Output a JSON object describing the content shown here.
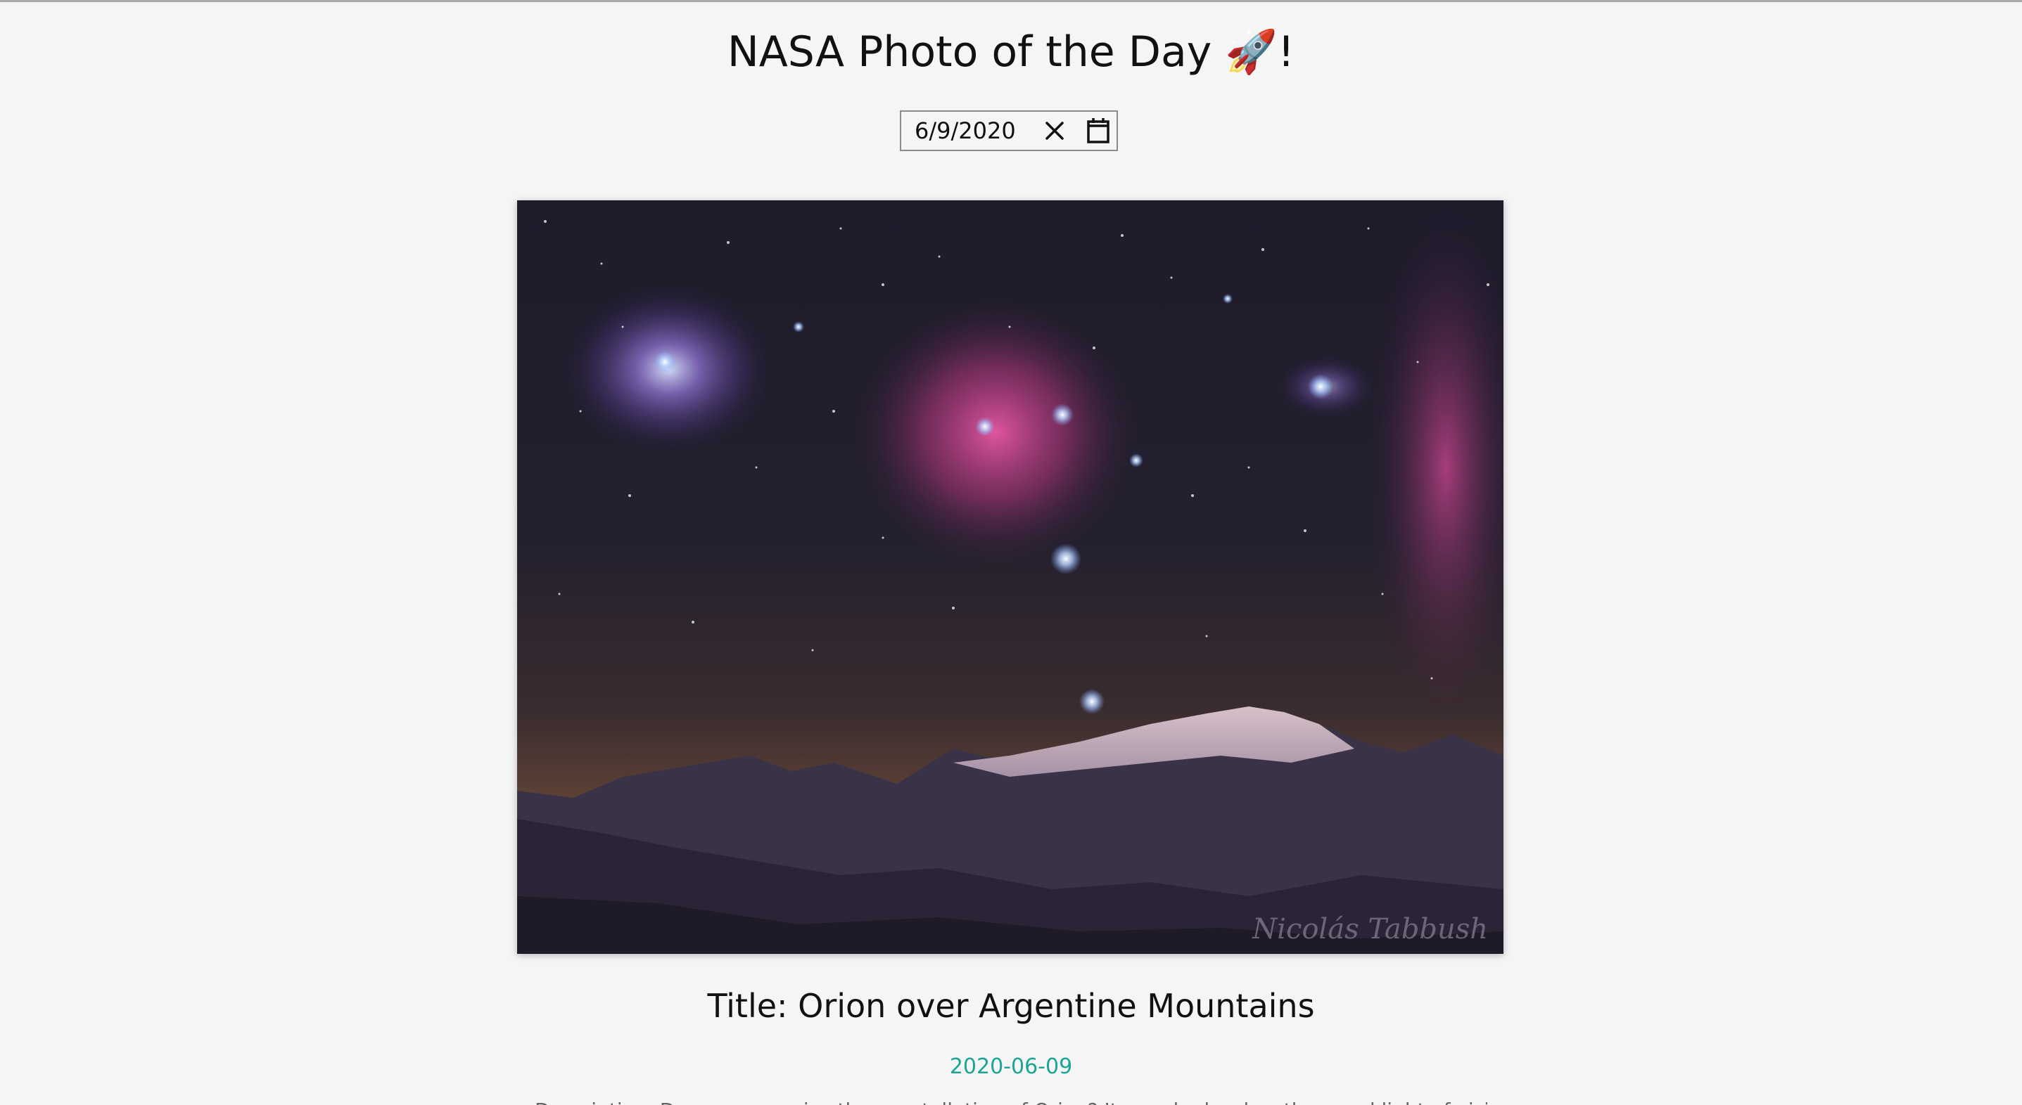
{
  "header": {
    "title": "NASA Photo of the Day 🚀!"
  },
  "date_picker": {
    "value": "6/9/2020",
    "clear_icon": "close-icon",
    "calendar_icon": "calendar-icon"
  },
  "photo": {
    "watermark": "Nicolás Tabbush"
  },
  "details": {
    "title": "Title: Orion over Argentine Mountains",
    "date": "2020-06-09",
    "explanation": "Description: Do you recognize the constellation of Orion? It may be hard as the usual light of visible stars is enhanced in infrared..."
  },
  "colors": {
    "background": "#f6f5f5",
    "date_accent": "#1aa594",
    "text": "#111111"
  }
}
